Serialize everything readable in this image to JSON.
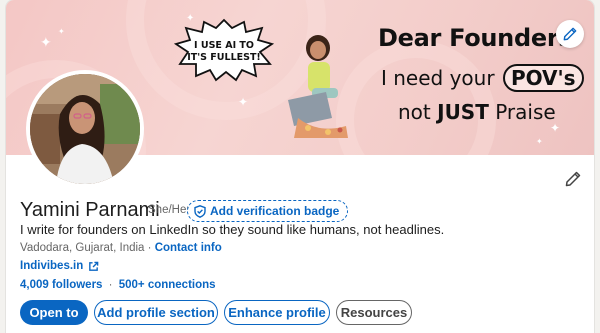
{
  "banner": {
    "speech_bubble_text": "I USE AI TO IT'S FULLEST!",
    "speech_line1": "I USE AI TO",
    "speech_line2": "IT'S FULLEST!",
    "headline_line1": "Dear Founders",
    "headline_line2_prefix": "I need your",
    "headline_line2_highlight": "POV's",
    "headline_line3_prefix": "not",
    "headline_line3_bold": "JUST",
    "headline_line3_suffix": "Praise",
    "background_color": "#f4c7c5"
  },
  "profile": {
    "name": "Yamini Parnami",
    "pronouns": "She/Her",
    "verification_badge_label": "Add verification badge",
    "bio": "I write for founders on LinkedIn so they sound like humans, not headlines.",
    "location": "Vadodara, Gujarat, India",
    "location_separator": "·",
    "contact_info_label": "Contact info",
    "website": "Indivibes.in",
    "followers": "4,009 followers",
    "stats_separator": "·",
    "connections": "500+ connections"
  },
  "actions": {
    "open_to": "Open to",
    "add_profile_section": "Add profile section",
    "enhance_profile": "Enhance profile",
    "resources": "Resources"
  },
  "icons": {
    "banner_edit": "pencil-icon",
    "profile_edit": "pencil-icon",
    "verify": "shield-check-icon",
    "website_external": "external-link-icon"
  },
  "colors": {
    "accent": "#0a66c2",
    "text": "#1d1d1d",
    "muted": "#666666"
  }
}
